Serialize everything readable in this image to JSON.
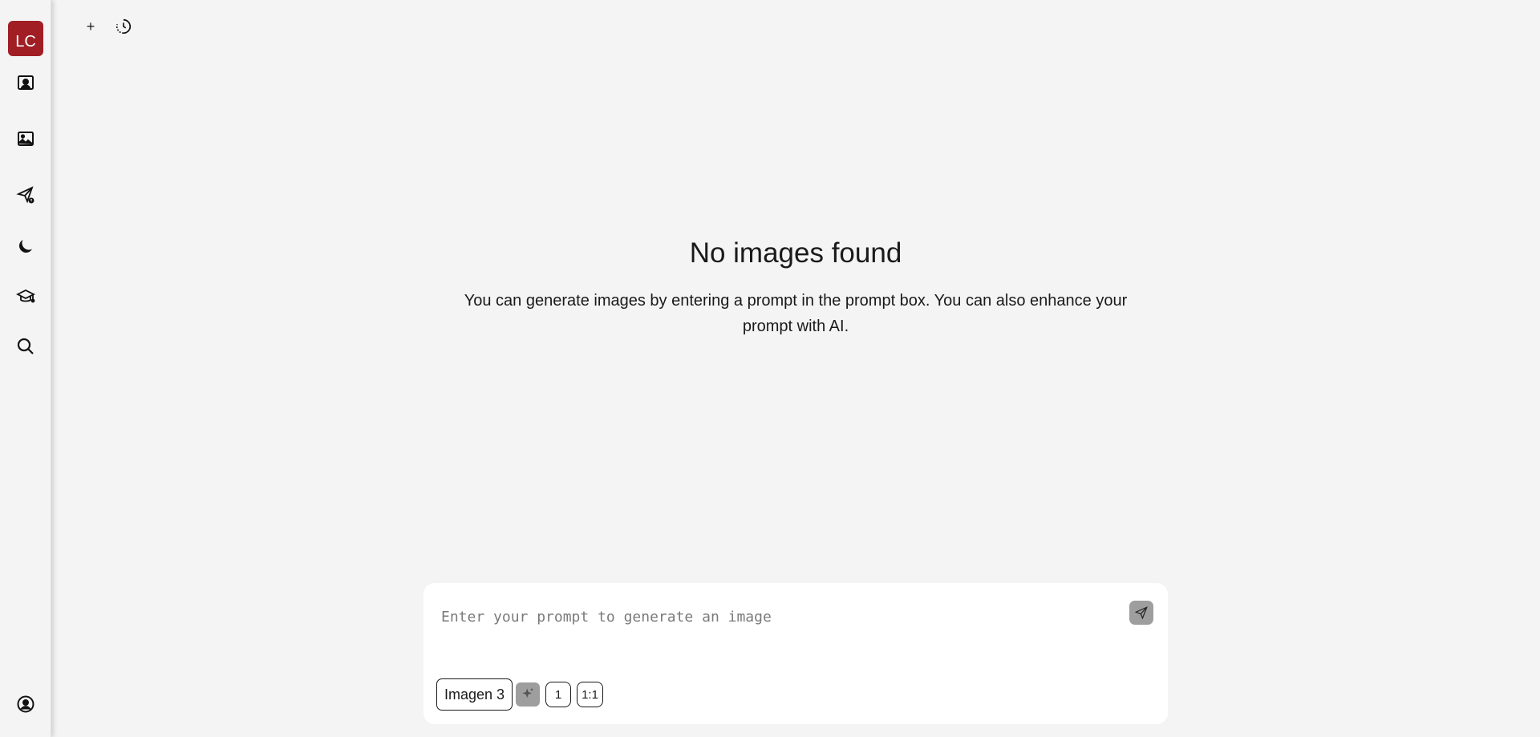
{
  "sidebar": {
    "avatar_initials": "LC",
    "items": [
      {
        "name": "portrait-icon"
      },
      {
        "name": "image-icon"
      },
      {
        "name": "send-alert-icon"
      },
      {
        "name": "moon-icon"
      },
      {
        "name": "graduation-cap-icon"
      },
      {
        "name": "search-icon"
      }
    ],
    "profile_icon": "user-circle-icon"
  },
  "topbar": {
    "new_label": "+",
    "history_icon": "history-icon"
  },
  "empty_state": {
    "title": "No images found",
    "description": "You can generate images by entering a prompt in the prompt box. You can also enhance your prompt with AI."
  },
  "prompt": {
    "placeholder": "Enter your prompt to generate an image",
    "value": "",
    "send_icon": "send-icon",
    "model_label": "Imagen 3",
    "enhance_icon": "sparkles-icon",
    "count_label": "1",
    "ratio_label": "1:1"
  },
  "colors": {
    "accent": "#a01e24",
    "background": "#f4f4f4",
    "button_gray": "#9e9e9e"
  }
}
